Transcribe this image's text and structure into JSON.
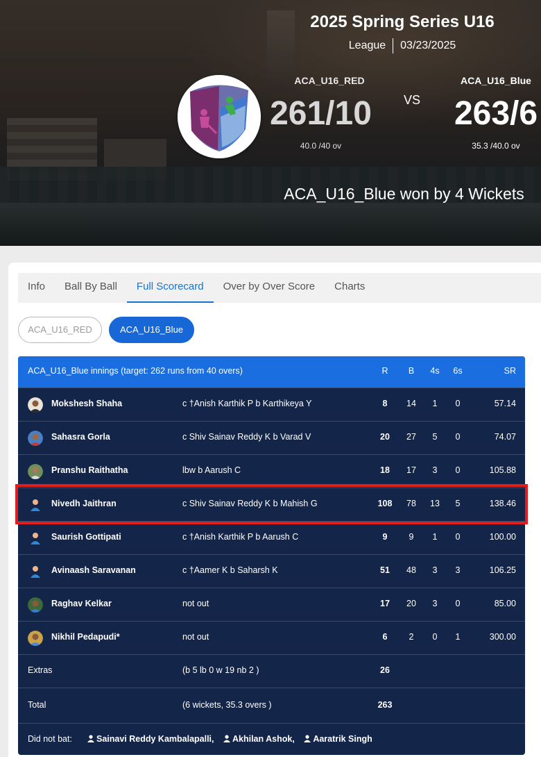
{
  "match": {
    "series_title": "2025 Spring Series U16",
    "match_type": "League",
    "date": "03/23/2025",
    "vs_label": "VS",
    "result": "ACA_U16_Blue won by 4 Wickets",
    "team1": {
      "name": "ACA_U16_RED",
      "score": "261/10",
      "overs": "40.0 /40 ov"
    },
    "team2": {
      "name": "ACA_U16_Blue",
      "score": "263/6",
      "overs": "35.3 /40.0 ov"
    }
  },
  "tabs": [
    "Info",
    "Ball By Ball",
    "Full Scorecard",
    "Over by Over Score",
    "Charts"
  ],
  "active_tab": "Full Scorecard",
  "team_toggle": {
    "inactive": "ACA_U16_RED",
    "active": "ACA_U16_Blue"
  },
  "scorecard": {
    "header": {
      "innings_title": "ACA_U16_Blue innings (target: 262 runs from 40 overs)",
      "r": "R",
      "b": "B",
      "fours": "4s",
      "sixes": "6s",
      "sr": "SR"
    },
    "batters": [
      {
        "name": "Mokshesh Shaha",
        "dismissal": "c †Anish Karthik P b Karthikeya Y",
        "r": "8",
        "b": "14",
        "fours": "1",
        "sixes": "0",
        "sr": "57.14"
      },
      {
        "name": "Sahasra Gorla",
        "dismissal": "c Shiv Sainav Reddy K b Varad V",
        "r": "20",
        "b": "27",
        "fours": "5",
        "sixes": "0",
        "sr": "74.07"
      },
      {
        "name": "Pranshu Raithatha",
        "dismissal": "lbw b Aarush C",
        "r": "18",
        "b": "17",
        "fours": "3",
        "sixes": "0",
        "sr": "105.88"
      },
      {
        "name": "Nivedh Jaithran",
        "dismissal": "c Shiv Sainav Reddy K b Mahish G",
        "r": "108",
        "b": "78",
        "fours": "13",
        "sixes": "5",
        "sr": "138.46"
      },
      {
        "name": "Saurish Gottipati",
        "dismissal": "c †Anish Karthik P b Aarush C",
        "r": "9",
        "b": "9",
        "fours": "1",
        "sixes": "0",
        "sr": "100.00"
      },
      {
        "name": "Avinaash Saravanan",
        "dismissal": "c †Aamer K b Saharsh K",
        "r": "51",
        "b": "48",
        "fours": "3",
        "sixes": "3",
        "sr": "106.25"
      },
      {
        "name": "Raghav Kelkar",
        "dismissal": "not out",
        "r": "17",
        "b": "20",
        "fours": "3",
        "sixes": "0",
        "sr": "85.00"
      },
      {
        "name": "Nikhil Pedapudi*",
        "dismissal": "not out",
        "r": "6",
        "b": "2",
        "fours": "0",
        "sixes": "1",
        "sr": "300.00"
      }
    ],
    "extras": {
      "label": "Extras",
      "detail": "(b 5 lb 0 w 19 nb 2 )",
      "value": "26"
    },
    "total": {
      "label": "Total",
      "detail": "(6 wickets, 35.3 overs )",
      "value": "263"
    },
    "did_not_bat": {
      "label": "Did not bat:",
      "players": [
        "Sainavi Reddy Kambalapalli,",
        "Akhilan Ashok,",
        "Aaratrik Singh"
      ]
    }
  },
  "colors": {
    "accent": "#1673d1",
    "header_bar": "#1a6ee0",
    "table_bg": "#14254a",
    "highlight_border": "#e11d1d"
  }
}
